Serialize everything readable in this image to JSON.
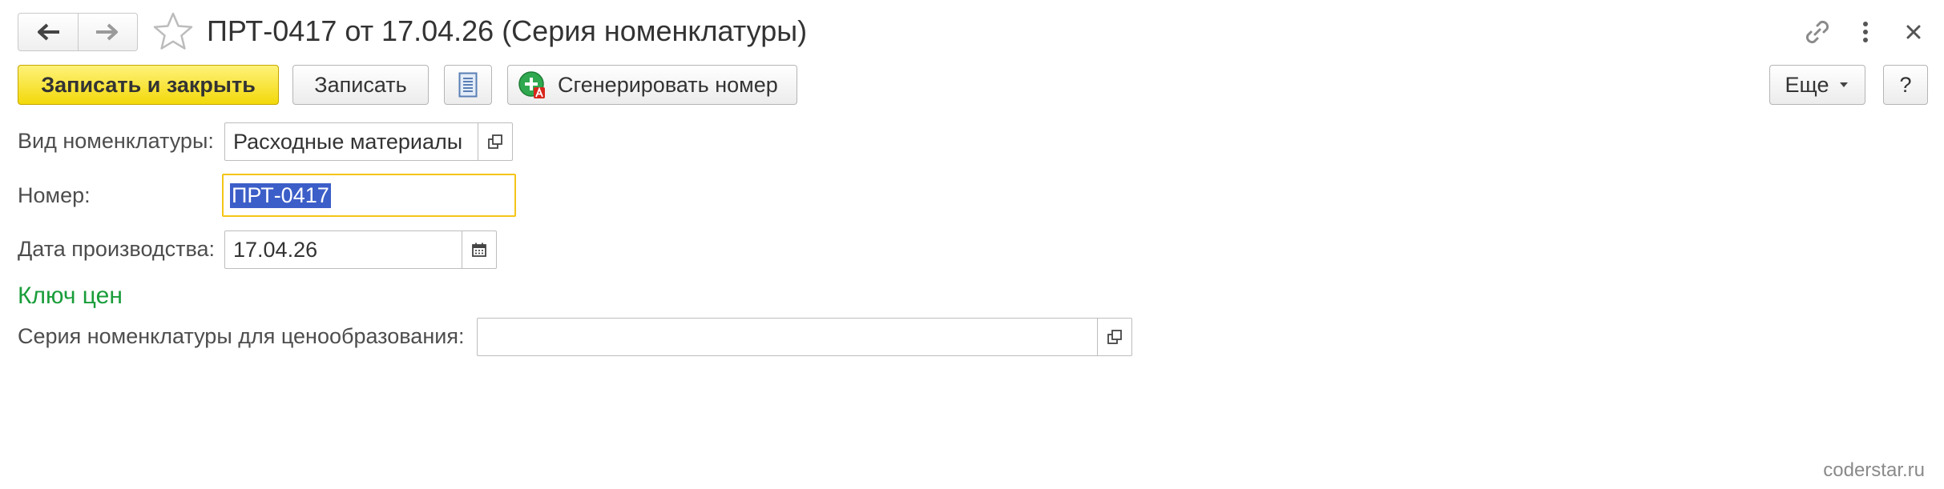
{
  "window": {
    "title": "ПРТ-0417 от 17.04.26 (Серия номенклатуры)",
    "icons": [
      "arrow-left-icon",
      "arrow-right-icon",
      "star-icon",
      "link-icon",
      "more-vertical-icon",
      "close-icon"
    ]
  },
  "toolbar": {
    "save_close_label": "Записать и закрыть",
    "save_label": "Записать",
    "generate_label": "Сгенерировать номер",
    "more_label": "Еще",
    "help_label": "?",
    "accent_color": "#f2d90a"
  },
  "form": {
    "kind": {
      "label": "Вид номенклатуры:",
      "value": "Расходные материалы"
    },
    "number": {
      "label": "Номер:",
      "value": "ПРТ-0417"
    },
    "date": {
      "label": "Дата производства:",
      "value": "17.04.26"
    },
    "price_key_title": "Ключ цен",
    "price_series": {
      "label": "Серия номенклатуры для ценообразования:",
      "value": ""
    }
  },
  "watermark": "coderstar.ru"
}
